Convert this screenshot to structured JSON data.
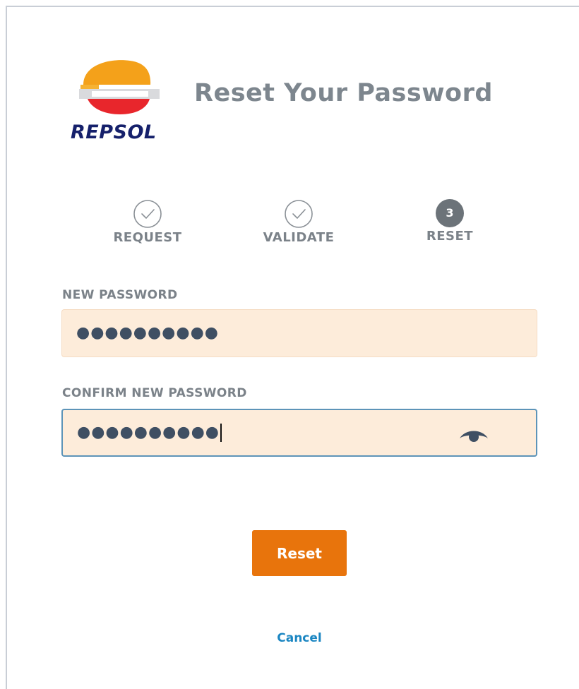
{
  "brand": {
    "logo_text": "REPSOL"
  },
  "page": {
    "title": "Reset Your Password"
  },
  "steps": [
    {
      "label": "REQUEST",
      "status": "done"
    },
    {
      "label": "VALIDATE",
      "status": "done"
    },
    {
      "label": "RESET",
      "status": "current",
      "number": "3"
    }
  ],
  "form": {
    "new_password": {
      "label": "NEW PASSWORD",
      "value_masked": "●●●●●●●●●●"
    },
    "confirm_password": {
      "label": "CONFIRM NEW PASSWORD",
      "value_masked": "●●●●●●●●●●",
      "toggle_icon": "eye-icon"
    }
  },
  "actions": {
    "reset_label": "Reset",
    "cancel_label": "Cancel"
  },
  "colors": {
    "accent": "#e8740c",
    "link": "#1b86c2",
    "field_bg": "#fdecda",
    "focus_border": "#5d94b8",
    "text_muted": "#7b8289"
  }
}
